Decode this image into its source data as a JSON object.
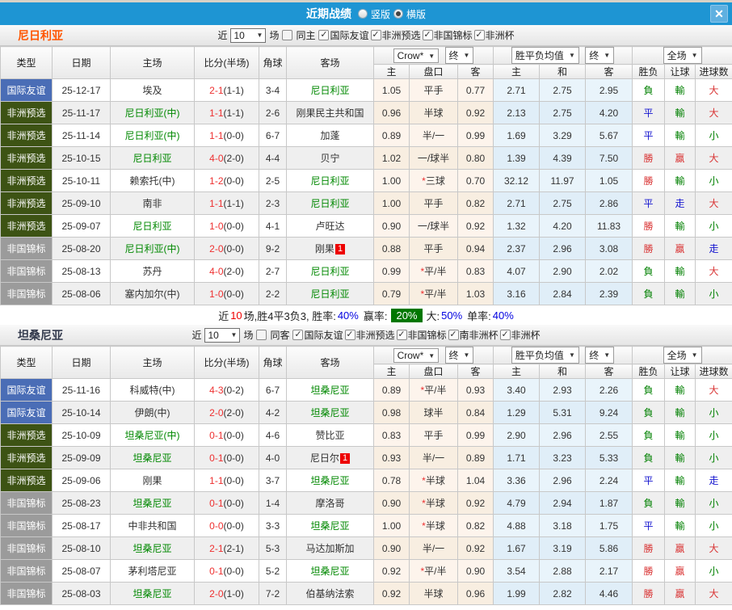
{
  "titlebar": {
    "title": "近期战绩",
    "vertical_label": "竖版",
    "horizontal_label": "横版",
    "close_label": "✕"
  },
  "filter_common": {
    "near": "近",
    "count": "10",
    "games": "场"
  },
  "table_header": {
    "type": "类型",
    "date": "日期",
    "home": "主场",
    "score": "比分(半场)",
    "corner": "角球",
    "away": "客场",
    "odds_company": "Crow*",
    "odds_stage": "终",
    "odds_home": "主",
    "odds_handicap": "盘口",
    "odds_away": "客",
    "avg_label": "胜平负均值",
    "avg_stage": "终",
    "avg_home": "主",
    "avg_draw": "和",
    "avg_away": "客",
    "fullmatch": "全场",
    "res_winloss": "胜负",
    "res_handicap": "让球",
    "res_goals": "进球数"
  },
  "colors": {
    "titlebar": "#1e95d3",
    "section1_team": "#ff5500",
    "section2_team": "#333a4d",
    "type_friendly": "#4a6db6",
    "type_qualifier": "#3d5314",
    "type_championship": "#9b9b9b",
    "team_green": "#008800",
    "score_red": "#ee2f2f",
    "win_red": "#d93434",
    "loss_green": "#008000",
    "push_blue": "#1515cf",
    "odds_col_bg": "#fdf4ec",
    "avg_col_bg": "#e9f4fb",
    "winrate_badge": "#007700"
  },
  "sections": [
    {
      "team": "尼日利亚",
      "filter": {
        "same": "同主",
        "leagues": [
          "国际友谊",
          "非洲预选",
          "非国锦标",
          "非洲杯"
        ]
      },
      "rows": [
        {
          "type": "国际友谊",
          "tc": "f",
          "date": "25-12-17",
          "home": "埃及",
          "hg": 0,
          "ft": "2-1",
          "ht": "(1-1)",
          "cr": "3-4",
          "away": "尼日利亚",
          "ag": 1,
          "o1": "1.05",
          "hc": "平手",
          "o2": "0.77",
          "m1": "2.71",
          "m2": "2.75",
          "m3": "2.95",
          "r1": "負",
          "c1": "g",
          "r2": "輸",
          "c2": "g",
          "r3": "大",
          "c3": "r"
        },
        {
          "type": "非洲预选",
          "tc": "q",
          "date": "25-11-17",
          "home": "尼日利亚(中)",
          "hg": 1,
          "ft": "1-1",
          "ht": "(1-1)",
          "cr": "2-6",
          "away": "刚果民主共和国",
          "ag": 0,
          "o1": "0.96",
          "hc": "半球",
          "o2": "0.92",
          "m1": "2.13",
          "m2": "2.75",
          "m3": "4.20",
          "r1": "平",
          "c1": "b",
          "r2": "輸",
          "c2": "g",
          "r3": "大",
          "c3": "r"
        },
        {
          "type": "非洲预选",
          "tc": "q",
          "date": "25-11-14",
          "home": "尼日利亚(中)",
          "hg": 1,
          "ft": "1-1",
          "ht": "(0-0)",
          "cr": "6-7",
          "away": "加蓬",
          "ag": 0,
          "o1": "0.89",
          "hc": "半/一",
          "o2": "0.99",
          "m1": "1.69",
          "m2": "3.29",
          "m3": "5.67",
          "r1": "平",
          "c1": "b",
          "r2": "輸",
          "c2": "g",
          "r3": "小",
          "c3": "g"
        },
        {
          "type": "非洲预选",
          "tc": "q",
          "date": "25-10-15",
          "home": "尼日利亚",
          "hg": 1,
          "ft": "4-0",
          "ht": "(2-0)",
          "cr": "4-4",
          "away": "贝宁",
          "ag": 0,
          "o1": "1.02",
          "hc": "一/球半",
          "o2": "0.80",
          "m1": "1.39",
          "m2": "4.39",
          "m3": "7.50",
          "r1": "勝",
          "c1": "r",
          "r2": "贏",
          "c2": "r",
          "r3": "大",
          "c3": "r"
        },
        {
          "type": "非洲预选",
          "tc": "q",
          "date": "25-10-11",
          "home": "赖索托(中)",
          "hg": 0,
          "ft": "1-2",
          "ht": "(0-0)",
          "cr": "2-5",
          "away": "尼日利亚",
          "ag": 1,
          "o1": "1.00",
          "hc": "*三球",
          "o2": "0.70",
          "m1": "32.12",
          "m2": "11.97",
          "m3": "1.05",
          "r1": "勝",
          "c1": "r",
          "r2": "輸",
          "c2": "g",
          "r3": "小",
          "c3": "g"
        },
        {
          "type": "非洲预选",
          "tc": "q",
          "date": "25-09-10",
          "home": "南非",
          "hg": 0,
          "ft": "1-1",
          "ht": "(1-1)",
          "cr": "2-3",
          "away": "尼日利亚",
          "ag": 1,
          "o1": "1.00",
          "hc": "平手",
          "o2": "0.82",
          "m1": "2.71",
          "m2": "2.75",
          "m3": "2.86",
          "r1": "平",
          "c1": "b",
          "r2": "走",
          "c2": "b",
          "r3": "大",
          "c3": "r"
        },
        {
          "type": "非洲预选",
          "tc": "q",
          "date": "25-09-07",
          "home": "尼日利亚",
          "hg": 1,
          "ft": "1-0",
          "ht": "(0-0)",
          "cr": "4-1",
          "away": "卢旺达",
          "ag": 0,
          "o1": "0.90",
          "hc": "一/球半",
          "o2": "0.92",
          "m1": "1.32",
          "m2": "4.20",
          "m3": "11.83",
          "r1": "勝",
          "c1": "r",
          "r2": "輸",
          "c2": "g",
          "r3": "小",
          "c3": "g"
        },
        {
          "type": "非国锦标",
          "tc": "c",
          "date": "25-08-20",
          "home": "尼日利亚(中)",
          "hg": 1,
          "ft": "2-0",
          "ht": "(0-0)",
          "cr": "9-2",
          "away": "刚果",
          "ag": 0,
          "ab": "1",
          "o1": "0.88",
          "hc": "平手",
          "o2": "0.94",
          "m1": "2.37",
          "m2": "2.96",
          "m3": "3.08",
          "r1": "勝",
          "c1": "r",
          "r2": "贏",
          "c2": "r",
          "r3": "走",
          "c3": "b"
        },
        {
          "type": "非国锦标",
          "tc": "c",
          "date": "25-08-13",
          "home": "苏丹",
          "hg": 0,
          "ft": "4-0",
          "ht": "(2-0)",
          "cr": "2-7",
          "away": "尼日利亚",
          "ag": 1,
          "o1": "0.99",
          "hc": "*平/半",
          "o2": "0.83",
          "m1": "4.07",
          "m2": "2.90",
          "m3": "2.02",
          "r1": "負",
          "c1": "g",
          "r2": "輸",
          "c2": "g",
          "r3": "大",
          "c3": "r"
        },
        {
          "type": "非国锦标",
          "tc": "c",
          "date": "25-08-06",
          "home": "塞内加尔(中)",
          "hg": 0,
          "ft": "1-0",
          "ht": "(0-0)",
          "cr": "2-2",
          "away": "尼日利亚",
          "ag": 1,
          "o1": "0.79",
          "hc": "*平/半",
          "o2": "1.03",
          "m1": "3.16",
          "m2": "2.84",
          "m3": "2.39",
          "r1": "負",
          "c1": "g",
          "r2": "輸",
          "c2": "g",
          "r3": "小",
          "c3": "g"
        }
      ],
      "summary": {
        "t1": "近",
        "n": "10",
        "t2": "场,胜4平3负3, 胜率:",
        "winrate": "40%",
        "t3": "赢率:",
        "winodds": "20%",
        "t4": "大:",
        "big": "50%",
        "t5": "单率:",
        "single": "40%"
      }
    },
    {
      "team": "坦桑尼亚",
      "filter": {
        "same": "同客",
        "leagues": [
          "国际友谊",
          "非洲预选",
          "非国锦标",
          "南非洲杯",
          "非洲杯"
        ]
      },
      "rows": [
        {
          "type": "国际友谊",
          "tc": "f",
          "date": "25-11-16",
          "home": "科威特(中)",
          "hg": 0,
          "ft": "4-3",
          "ht": "(0-2)",
          "cr": "6-7",
          "away": "坦桑尼亚",
          "ag": 1,
          "o1": "0.89",
          "hc": "*平/半",
          "o2": "0.93",
          "m1": "3.40",
          "m2": "2.93",
          "m3": "2.26",
          "r1": "負",
          "c1": "g",
          "r2": "輸",
          "c2": "g",
          "r3": "大",
          "c3": "r"
        },
        {
          "type": "国际友谊",
          "tc": "f",
          "date": "25-10-14",
          "home": "伊朗(中)",
          "hg": 0,
          "ft": "2-0",
          "ht": "(2-0)",
          "cr": "4-2",
          "away": "坦桑尼亚",
          "ag": 1,
          "o1": "0.98",
          "hc": "球半",
          "o2": "0.84",
          "m1": "1.29",
          "m2": "5.31",
          "m3": "9.24",
          "r1": "負",
          "c1": "g",
          "r2": "輸",
          "c2": "g",
          "r3": "小",
          "c3": "g"
        },
        {
          "type": "非洲预选",
          "tc": "q",
          "date": "25-10-09",
          "home": "坦桑尼亚(中)",
          "hg": 1,
          "ft": "0-1",
          "ht": "(0-0)",
          "cr": "4-6",
          "away": "赞比亚",
          "ag": 0,
          "o1": "0.83",
          "hc": "平手",
          "o2": "0.99",
          "m1": "2.90",
          "m2": "2.96",
          "m3": "2.55",
          "r1": "負",
          "c1": "g",
          "r2": "輸",
          "c2": "g",
          "r3": "小",
          "c3": "g"
        },
        {
          "type": "非洲预选",
          "tc": "q",
          "date": "25-09-09",
          "home": "坦桑尼亚",
          "hg": 1,
          "ft": "0-1",
          "ht": "(0-0)",
          "cr": "4-0",
          "away": "尼日尔",
          "ag": 0,
          "ab": "1",
          "o1": "0.93",
          "hc": "半/一",
          "o2": "0.89",
          "m1": "1.71",
          "m2": "3.23",
          "m3": "5.33",
          "r1": "負",
          "c1": "g",
          "r2": "輸",
          "c2": "g",
          "r3": "小",
          "c3": "g"
        },
        {
          "type": "非洲预选",
          "tc": "q",
          "date": "25-09-06",
          "home": "刚果",
          "hg": 0,
          "ft": "1-1",
          "ht": "(0-0)",
          "cr": "3-7",
          "away": "坦桑尼亚",
          "ag": 1,
          "o1": "0.78",
          "hc": "*半球",
          "o2": "1.04",
          "m1": "3.36",
          "m2": "2.96",
          "m3": "2.24",
          "r1": "平",
          "c1": "b",
          "r2": "輸",
          "c2": "g",
          "r3": "走",
          "c3": "b"
        },
        {
          "type": "非国锦标",
          "tc": "c",
          "date": "25-08-23",
          "home": "坦桑尼亚",
          "hg": 1,
          "ft": "0-1",
          "ht": "(0-0)",
          "cr": "1-4",
          "away": "摩洛哥",
          "ag": 0,
          "o1": "0.90",
          "hc": "*半球",
          "o2": "0.92",
          "m1": "4.79",
          "m2": "2.94",
          "m3": "1.87",
          "r1": "負",
          "c1": "g",
          "r2": "輸",
          "c2": "g",
          "r3": "小",
          "c3": "g"
        },
        {
          "type": "非国锦标",
          "tc": "c",
          "date": "25-08-17",
          "home": "中非共和国",
          "hg": 0,
          "ft": "0-0",
          "ht": "(0-0)",
          "cr": "3-3",
          "away": "坦桑尼亚",
          "ag": 1,
          "o1": "1.00",
          "hc": "*半球",
          "o2": "0.82",
          "m1": "4.88",
          "m2": "3.18",
          "m3": "1.75",
          "r1": "平",
          "c1": "b",
          "r2": "輸",
          "c2": "g",
          "r3": "小",
          "c3": "g"
        },
        {
          "type": "非国锦标",
          "tc": "c",
          "date": "25-08-10",
          "home": "坦桑尼亚",
          "hg": 1,
          "ft": "2-1",
          "ht": "(2-1)",
          "cr": "5-3",
          "away": "马达加斯加",
          "ag": 0,
          "o1": "0.90",
          "hc": "半/一",
          "o2": "0.92",
          "m1": "1.67",
          "m2": "3.19",
          "m3": "5.86",
          "r1": "勝",
          "c1": "r",
          "r2": "贏",
          "c2": "r",
          "r3": "大",
          "c3": "r"
        },
        {
          "type": "非国锦标",
          "tc": "c",
          "date": "25-08-07",
          "home": "茅利塔尼亚",
          "hg": 0,
          "ft": "0-1",
          "ht": "(0-0)",
          "cr": "5-2",
          "away": "坦桑尼亚",
          "ag": 1,
          "o1": "0.92",
          "hc": "*平/半",
          "o2": "0.90",
          "m1": "3.54",
          "m2": "2.88",
          "m3": "2.17",
          "r1": "勝",
          "c1": "r",
          "r2": "贏",
          "c2": "r",
          "r3": "小",
          "c3": "g"
        },
        {
          "type": "非国锦标",
          "tc": "c",
          "date": "25-08-03",
          "home": "坦桑尼亚",
          "hg": 1,
          "ft": "2-0",
          "ht": "(1-0)",
          "cr": "7-2",
          "away": "伯基纳法索",
          "ag": 0,
          "o1": "0.92",
          "hc": "半球",
          "o2": "0.96",
          "m1": "1.99",
          "m2": "2.82",
          "m3": "4.46",
          "r1": "勝",
          "c1": "r",
          "r2": "贏",
          "c2": "r",
          "r3": "大",
          "c3": "r"
        }
      ]
    }
  ]
}
